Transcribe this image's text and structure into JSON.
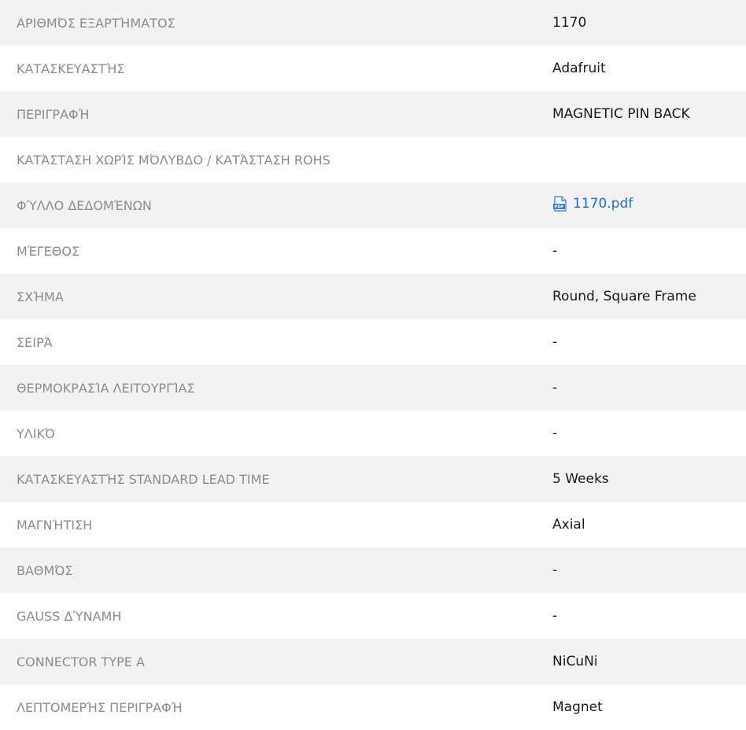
{
  "specs": [
    {
      "label": "ΑΡΙΘΜΌΣ ΕΞΑΡΤΉΜΑΤΟΣ",
      "value": "1170"
    },
    {
      "label": "ΚΑΤΑΣΚΕΥΑΣΤΉΣ",
      "value": "Adafruit"
    },
    {
      "label": "ΠΕΡΙΓΡΑΦΉ",
      "value": "MAGNETIC PIN BACK"
    },
    {
      "label": "ΚΑΤΆΣΤΑΣΗ ΧΩΡΊΣ ΜΌΛΥΒΔΟ / ΚΑΤΆΣΤΑΣΗ ROHS",
      "value": ""
    },
    {
      "label": "ΦΎΛΛΟ ΔΕΔΟΜΈΝΩΝ",
      "value": "1170.pdf"
    },
    {
      "label": "ΜΈΓΕΘΟΣ",
      "value": "-"
    },
    {
      "label": "ΣΧΉΜΑ",
      "value": "Round, Square Frame"
    },
    {
      "label": "ΣΕΙΡΆ",
      "value": "-"
    },
    {
      "label": "ΘΕΡΜΟΚΡΑΣΊΑ ΛΕΙΤΟΥΡΓΊΑΣ",
      "value": "-"
    },
    {
      "label": "ΥΛΙΚΌ",
      "value": "-"
    },
    {
      "label": "ΚΑΤΑΣΚΕΥΑΣΤΉΣ STANDARD LEAD TIME",
      "value": "5 Weeks"
    },
    {
      "label": "ΜΑΓΝΉΤΙΣΗ",
      "value": "Axial"
    },
    {
      "label": "ΒΑΘΜΌΣ",
      "value": "-"
    },
    {
      "label": "GAUSS ΔΎΝΑΜΗ",
      "value": "-"
    },
    {
      "label": "CONNECTOR TYPE A",
      "value": "NiCuNi"
    },
    {
      "label": "ΛΕΠΤΟΜΕΡΉΣ ΠΕΡΙΓΡΑΦΉ",
      "value": "Magnet"
    }
  ],
  "icons": {
    "datasheet": "pdf-file-icon"
  },
  "colors": {
    "stripe": "#f2f2f2",
    "label": "#8c8c8c",
    "value": "#1a1a1a",
    "link": "#1a6fc9"
  }
}
